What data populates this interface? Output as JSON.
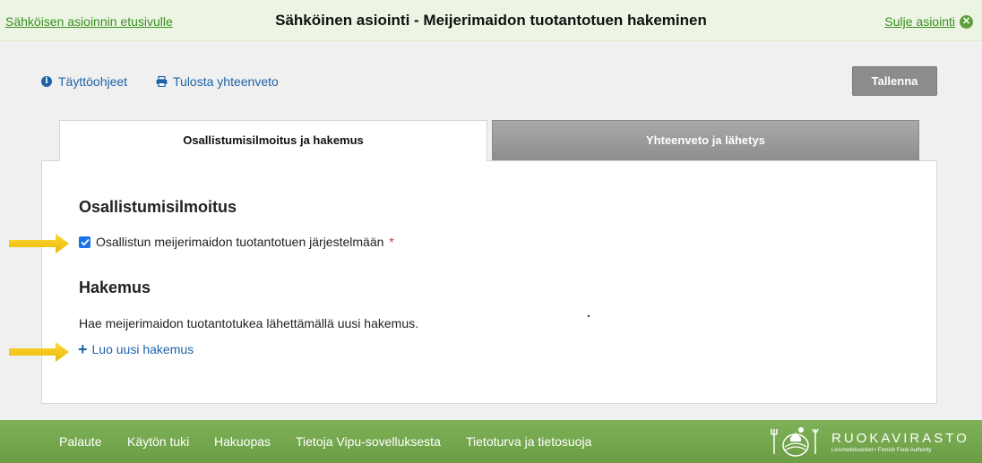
{
  "topbar": {
    "home_link": "Sähköisen asioinnin etusivulle",
    "title": "Sähköinen asiointi - Meijerimaidon tuotantotuen hakeminen",
    "close_link": "Sulje asiointi",
    "close_icon": "close-circle-icon"
  },
  "tools": {
    "instructions": "Täyttöohjeet",
    "print_summary": "Tulosta yhteenveto",
    "save": "Tallenna"
  },
  "tabs": [
    {
      "label": "Osallistumisilmoitus ja hakemus",
      "active": true
    },
    {
      "label": "Yhteenveto ja lähetys",
      "active": false
    }
  ],
  "participation": {
    "heading": "Osallistumisilmoitus",
    "checkbox_label": "Osallistun meijerimaidon tuotantotuen järjestelmään",
    "checked": true,
    "required_mark": "*"
  },
  "application": {
    "heading": "Hakemus",
    "description": "Hae meijerimaidon tuotantotukea lähettämällä uusi hakemus.",
    "new_application": "Luo uusi hakemus"
  },
  "footer": {
    "links": [
      "Palaute",
      "Käytön tuki",
      "Hakuopas",
      "Tietoja Vipu-sovelluksesta",
      "Tietoturva ja tietosuoja"
    ],
    "logo_name": "RUOKAVIRASTO",
    "logo_sub": "Livsmedelsverket • Finnish Food Authority"
  },
  "colors": {
    "topbar_bg": "#ecf5e4",
    "link_green": "#3b8f1f",
    "link_blue": "#1e63a8",
    "footer_green": "#75a74e",
    "arrow_yellow": "#f5c400"
  }
}
